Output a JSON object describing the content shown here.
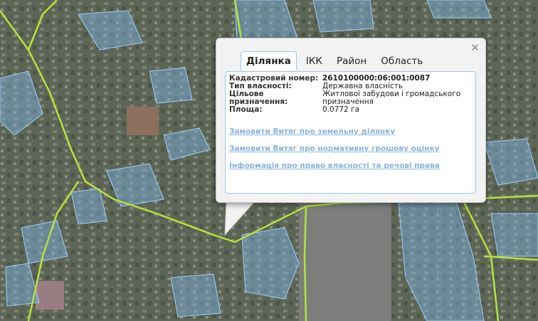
{
  "popup": {
    "close_icon": "close-icon",
    "tabs": [
      "Ділянка",
      "ІКК",
      "Район",
      "Область"
    ],
    "active_tab": "Ділянка",
    "fields": [
      {
        "label": "Кадастровий номер:",
        "value": "2610100000:06:001:0087"
      },
      {
        "label": "Тип власності:",
        "value": "Державна власність"
      },
      {
        "label": "Цільове призначення:",
        "value": "Житлової забудови і громадського призначення"
      },
      {
        "label": "Площа:",
        "value": "0.0772 га"
      }
    ],
    "links": [
      "Замовити Витяг про земельну ділянку",
      "Замовити Витяг про нормативну грошову оцінку",
      "Інформація про право власності та речові права"
    ]
  },
  "colors": {
    "parcel_fill": "#7fb4e6",
    "parcel_stroke": "#9fd0ff",
    "road_line": "#b8e23c",
    "link": "#8ab4de",
    "panel_border": "#9ec6ea"
  }
}
